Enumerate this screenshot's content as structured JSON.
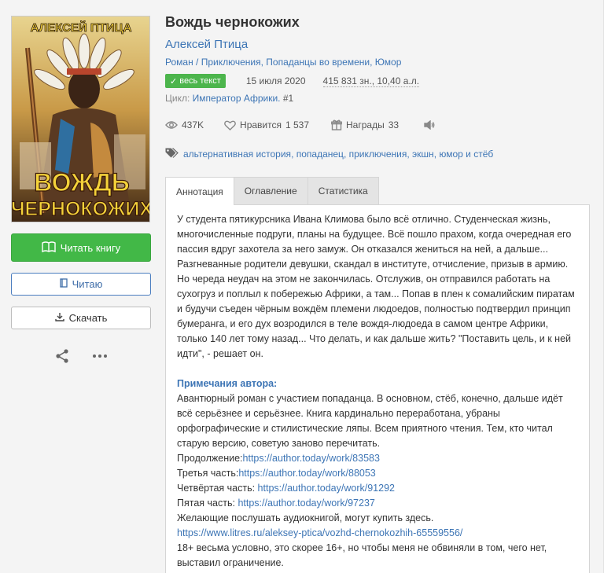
{
  "book": {
    "title": "Вождь чернокожих",
    "author": "Алексей Птица",
    "genres": [
      "Роман",
      "Приключения",
      "Попаданцы во времени",
      "Юмор"
    ],
    "badge": "весь текст",
    "date": "15 июля 2020",
    "size": "415 831 зн., 10,40 а.л.",
    "cycle_label": "Цикл:",
    "cycle_name": "Император Африки.",
    "cycle_num": "#1"
  },
  "cover": {
    "author_line": "АЛЕКСЕЙ ПТИЦА",
    "title_line1": "ВОЖДЬ",
    "title_line2": "ЧЕРНОКОЖИХ"
  },
  "stats": {
    "views": "437K",
    "likes_label": "Нравится",
    "likes": "1 537",
    "awards_label": "Награды",
    "awards": "33"
  },
  "tags": [
    "альтернативная история",
    "попаданец",
    "приключения",
    "экшн",
    "юмор и стёб"
  ],
  "buttons": {
    "read": "Читать книгу",
    "reading": "Читаю",
    "download": "Скачать"
  },
  "tabs": [
    "Аннотация",
    "Оглавление",
    "Статистика"
  ],
  "annotation": {
    "text": "У студента пятикурсника Ивана Климова было всё отлично. Студенческая жизнь, многочисленные подруги, планы на будущее. Всё пошло прахом, когда очередная его пассия вдруг захотела за него замуж. Он отказался жениться на ней, а дальше... Разгневанные родители девушки, скандал в институте, отчисление, призыв в армию. Но череда неудач на этом не закончилась. Отслужив, он отправился работать на сухогруз и поплыл к побережью Африки, а там... Попав в плен к сомалийским пиратам и будучи съеден чёрным вождём племени людоедов, полностью подтвердил принцип бумеранга, и его дух возродился в теле вождя-людоеда в самом центре Африки, только 140 лет тому назад... Что делать, и как дальше жить? \"Поставить цель, и к ней идти\", - решает он.",
    "notes_title": "Примечания автора:",
    "notes_text": "Авантюрный роман с участием попаданца. В основном, стёб, конечно, дальше идёт всё серьёзнее и серьёзнее. Книга кардинально переработана, убраны орфографические и стилистические ляпы. Всем приятного чтения. Тем, кто читал старую версию, советую заново перечитать.",
    "cont_label": "Продолжение:",
    "cont_link": "https://author.today/work/83583",
    "part3_label": "Третья часть:",
    "part3_link": "https://author.today/work/88053",
    "part4_label": "Четвёртая часть: ",
    "part4_link": "https://author.today/work/91292",
    "part5_label": "Пятая часть: ",
    "part5_link": "https://author.today/work/97237",
    "audio_text": "Желающие послушать аудиокнигой, могут купить здесь.",
    "audio_link": "https://www.litres.ru/aleksey-ptica/vozhd-chernokozhih-65559556/",
    "age_text": "18+ весьма условно, это скорее 16+, но чтобы меня не обвиняли в том, чего нет, выставил ограничение."
  }
}
